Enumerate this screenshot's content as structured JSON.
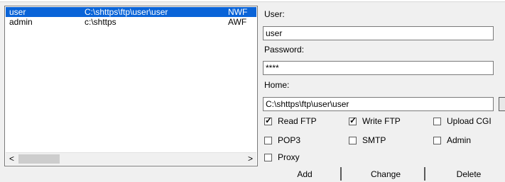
{
  "users": [
    {
      "name": "user",
      "home": "C:\\shttps\\ftp\\user\\user",
      "flags": "NWF",
      "selected": true
    },
    {
      "name": "admin",
      "home": "c:\\shttps",
      "flags": "AWF",
      "selected": false
    }
  ],
  "scrollbar": {
    "left_arrow": "<",
    "right_arrow": ">"
  },
  "form": {
    "user_label": "User:",
    "user_value": "user",
    "password_label": "Password:",
    "password_value": "****",
    "home_label": "Home:",
    "home_value": "C:\\shttps\\ftp\\user\\user"
  },
  "permissions": [
    {
      "label": "Read FTP",
      "checked": true
    },
    {
      "label": "Write FTP",
      "checked": true
    },
    {
      "label": "Upload CGI",
      "checked": false
    },
    {
      "label": "POP3",
      "checked": false
    },
    {
      "label": "SMTP",
      "checked": false
    },
    {
      "label": "Admin",
      "checked": false
    },
    {
      "label": "Proxy",
      "checked": false
    }
  ],
  "buttons": {
    "add": "Add",
    "change": "Change",
    "delete": "Delete"
  }
}
